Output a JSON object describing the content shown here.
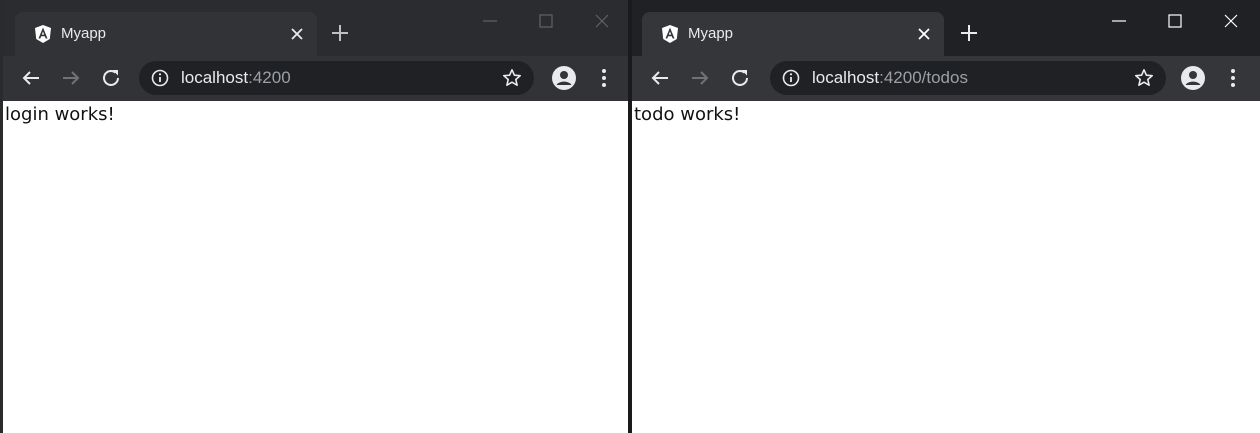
{
  "windows": [
    {
      "tab": {
        "title": "Myapp"
      },
      "address": {
        "host": "localhost",
        "path": ":4200"
      },
      "page": {
        "text": "login works!"
      }
    },
    {
      "tab": {
        "title": "Myapp"
      },
      "address": {
        "host": "localhost",
        "path": ":4200/todos"
      },
      "page": {
        "text": "todo works!"
      }
    }
  ],
  "icons": {
    "favicon": "angular-icon",
    "close": "close-icon",
    "new_tab": "plus-icon",
    "back": "back-arrow-icon",
    "forward": "forward-arrow-icon",
    "reload": "reload-icon",
    "info": "info-icon",
    "bookmark": "star-icon",
    "profile": "account-icon",
    "menu": "kebab-menu-icon",
    "minimize": "minimize-icon",
    "maximize": "maximize-icon"
  },
  "colors": {
    "frame": "#202124",
    "toolbar": "#35363a",
    "omnibox": "#202124",
    "text": "#e8eaed",
    "dim": "#9aa0a6"
  }
}
